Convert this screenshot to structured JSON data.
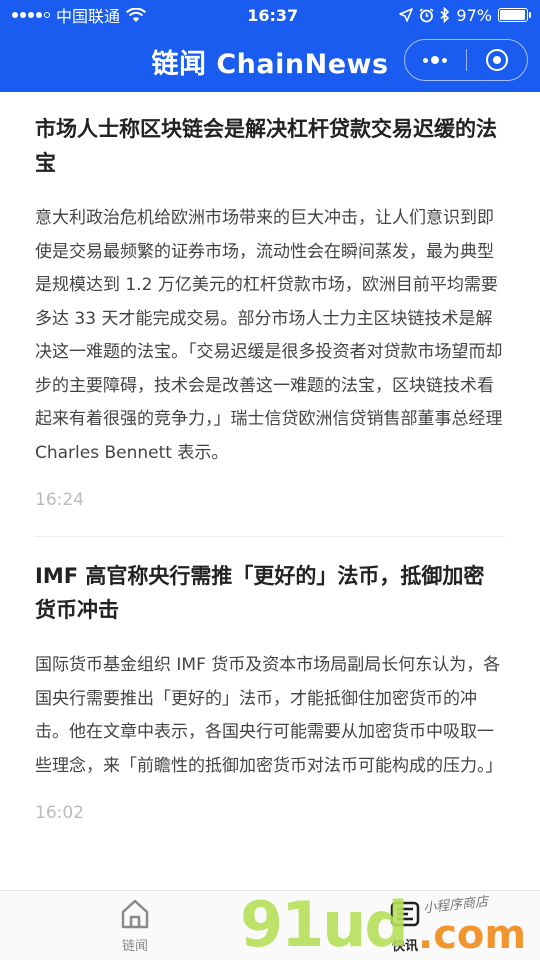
{
  "status_bar": {
    "carrier": "中国联通",
    "time": "16:37",
    "battery": "97%",
    "battery_level": 0.97
  },
  "navbar": {
    "title": "链闻 ChainNews"
  },
  "articles": [
    {
      "title": "市场人士称区块链会是解决杠杆贷款交易迟缓的法宝",
      "body": "意大利政治危机给欧洲市场带来的巨大冲击，让人们意识到即使是交易最频繁的证券市场，流动性会在瞬间蒸发，最为典型是规模达到 1.2 万亿美元的杠杆贷款市场，欧洲目前平均需要多达 33 天才能完成交易。部分市场人士力主区块链技术是解决这一难题的法宝。「交易迟缓是很多投资者对贷款市场望而却步的主要障碍，技术会是改善这一难题的法宝，区块链技术看起来有着很强的竞争力，」瑞士信贷欧洲信贷销售部董事总经理 Charles Bennett 表示。",
      "time": "16:24"
    },
    {
      "title": "IMF 高官称央行需推「更好的」法币，抵御加密货币冲击",
      "body": "国际货币基金组织 IMF 货币及资本市场局副局长何东认为，各国央行需要推出「更好的」法币，才能抵御住加密货币的冲击。他在文章中表示，各国央行可能需要从加密货币中吸取一些理念，来「前瞻性的抵御加密货币对法币可能构成的压力。」",
      "time": "16:02"
    }
  ],
  "tabbar": {
    "tabs": [
      {
        "label": "链闻",
        "icon": "home-icon",
        "active": false
      },
      {
        "label": "快讯",
        "icon": "newsflash-icon",
        "active": true
      }
    ]
  },
  "watermark": {
    "main": "91ud",
    "suffix": ".com",
    "tagline": "小程序商店"
  },
  "colors": {
    "brand_blue": "#1a5cf0",
    "time_gray": "#bbbbbb"
  }
}
